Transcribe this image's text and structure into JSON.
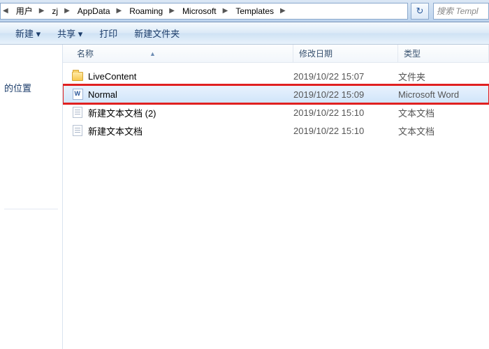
{
  "breadcrumbs": [
    "用户",
    "zj",
    "AppData",
    "Roaming",
    "Microsoft",
    "Templates"
  ],
  "search_placeholder": "搜索 Templ",
  "toolbar": {
    "new_menu": "新建 ▾",
    "share_menu": "共享 ▾",
    "print": "打印",
    "new_folder": "新建文件夹"
  },
  "leftnav": {
    "item0": "的位置"
  },
  "columns": {
    "name": "名称",
    "date": "修改日期",
    "type": "类型"
  },
  "rows": [
    {
      "icon": "folder",
      "name": "LiveContent",
      "date": "2019/10/22 15:07",
      "type": "文件夹",
      "selected": false,
      "boxed": false
    },
    {
      "icon": "word",
      "name": "Normal",
      "date": "2019/10/22 15:09",
      "type": "Microsoft Word ",
      "selected": true,
      "boxed": true
    },
    {
      "icon": "txt",
      "name": "新建文本文档 (2)",
      "date": "2019/10/22 15:10",
      "type": "文本文档",
      "selected": false,
      "boxed": false
    },
    {
      "icon": "txt",
      "name": "新建文本文档",
      "date": "2019/10/22 15:10",
      "type": "文本文档",
      "selected": false,
      "boxed": false
    }
  ]
}
